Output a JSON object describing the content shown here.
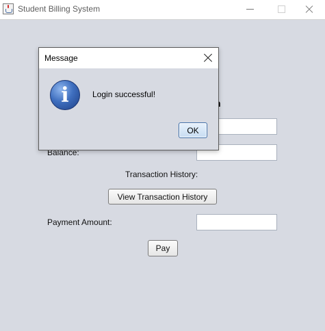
{
  "window": {
    "title": "Student Billing System"
  },
  "main": {
    "heading_partial": "n",
    "balance_label": "Balance:",
    "transaction_history_label": "Transaction History:",
    "view_history_button": "View Transaction History",
    "payment_amount_label": "Payment Amount:",
    "pay_button": "Pay"
  },
  "dialog": {
    "title": "Message",
    "message": "Login successful!",
    "ok_button": "OK",
    "icon": "info-icon"
  },
  "colors": {
    "background": "#d7dae2",
    "titlebar": "#ffffff",
    "info_icon": "#3f6fbf",
    "ok_border": "#3e6ea8"
  }
}
